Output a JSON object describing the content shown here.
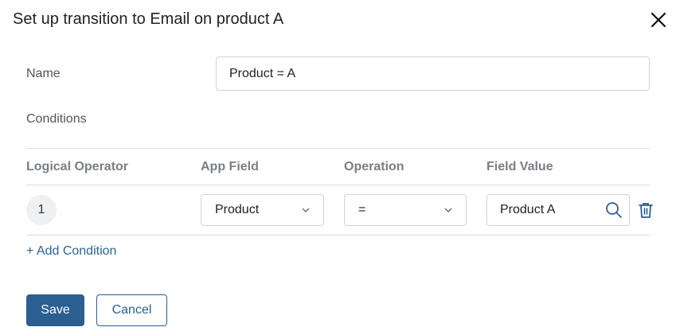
{
  "dialog": {
    "title": "Set up transition to Email on product A",
    "close_icon": "close-icon"
  },
  "form": {
    "name_label": "Name",
    "name_value": "Product = A",
    "conditions_label": "Conditions"
  },
  "table": {
    "headers": [
      "Logical Operator",
      "App Field",
      "Operation",
      "Field Value"
    ],
    "rows": [
      {
        "number": "1",
        "app_field": "Product",
        "operation": "=",
        "field_value": "Product A"
      }
    ]
  },
  "add_condition_label": "+ Add Condition",
  "buttons": {
    "save": "Save",
    "cancel": "Cancel"
  },
  "colors": {
    "accent": "#2a5f8f",
    "link": "#2a6496",
    "border": "#cfd4d9"
  },
  "icons": [
    "close-icon",
    "chevron-down-icon",
    "search-icon",
    "trash-icon"
  ]
}
